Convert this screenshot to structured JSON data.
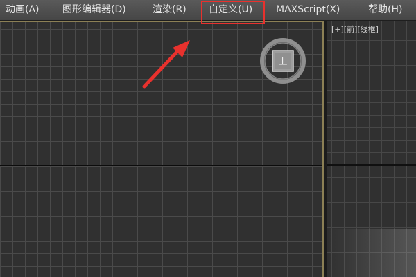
{
  "menubar": {
    "items": [
      {
        "id": "animation",
        "label": "动画(A)"
      },
      {
        "id": "graph-editors",
        "label": "图形编辑器(D)"
      },
      {
        "id": "rendering",
        "label": "渲染(R)"
      },
      {
        "id": "customize",
        "label": "自定义(U)"
      },
      {
        "id": "maxscript",
        "label": "MAXScript(X)"
      },
      {
        "id": "help",
        "label": "帮助(H)"
      }
    ]
  },
  "side_viewport": {
    "label": "[+][前][线框]"
  },
  "annotation": {
    "highlight_color": "#e8312d",
    "highlighted_item": "customize"
  },
  "viewcube": {
    "icon": "viewcube-icon"
  },
  "colors": {
    "active_viewport_border": "#8c8055",
    "grid_line": "#4a4a4a",
    "viewport_bg": "#303030"
  }
}
